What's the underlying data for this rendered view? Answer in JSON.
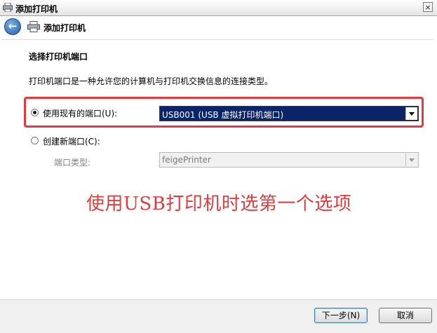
{
  "window": {
    "title": "添加打印机",
    "close_symbol": "×"
  },
  "nav": {
    "back_symbol": "←",
    "title": "添加打印机"
  },
  "section": {
    "title": "选择打印机端口",
    "description": "打印机端口是一种允许您的计算机与打印机交换信息的连接类型。"
  },
  "options": {
    "existing_port": {
      "label": "使用现有的端口(U):",
      "selected": true,
      "value": "USB001 (USB 虚拟打印机端口)"
    },
    "new_port": {
      "label": "创建新端口(C):",
      "selected": false,
      "type_label": "端口类型:",
      "type_value": "feigePrinter"
    }
  },
  "annotation": "使用USB打印机时选第一个选项",
  "buttons": {
    "next": "下一步(N)",
    "cancel": "取消"
  },
  "colors": {
    "highlight": "#e33b3b",
    "selected_bg": "#0a246a"
  }
}
